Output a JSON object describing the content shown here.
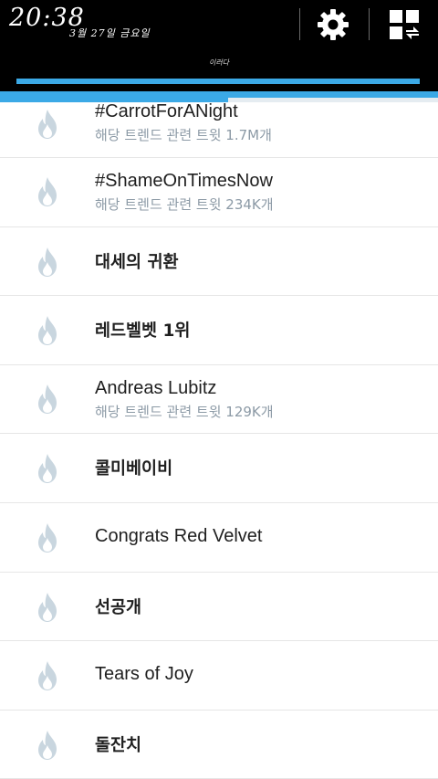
{
  "status": {
    "clock": "20:38",
    "date": "3월 27일 금요일"
  },
  "tab": {
    "label": "이러다"
  },
  "icons": {
    "settings": "gear-icon",
    "layout": "apps-swap-icon",
    "trend": "flame-icon"
  },
  "colors": {
    "accent": "#3ba9e6",
    "flame": "#c9d6df",
    "subtext": "#8c9aa6"
  },
  "trends": [
    {
      "title": "#CarrotForANight",
      "sub": "해당 트렌드 관련 트윗 1.7M개",
      "bold": false
    },
    {
      "title": "#ShameOnTimesNow",
      "sub": "해당 트렌드 관련 트윗 234K개",
      "bold": false
    },
    {
      "title": "대세의 귀환",
      "sub": "",
      "bold": true
    },
    {
      "title": "레드벨벳 1위",
      "sub": "",
      "bold": true
    },
    {
      "title": "Andreas Lubitz",
      "sub": "해당 트렌드 관련 트윗 129K개",
      "bold": false
    },
    {
      "title": "콜미베이비",
      "sub": "",
      "bold": true
    },
    {
      "title": "Congrats Red Velvet",
      "sub": "",
      "bold": false
    },
    {
      "title": "선공개",
      "sub": "",
      "bold": true
    },
    {
      "title": "Tears of Joy",
      "sub": "",
      "bold": false
    },
    {
      "title": "돌잔치",
      "sub": "",
      "bold": true
    }
  ]
}
